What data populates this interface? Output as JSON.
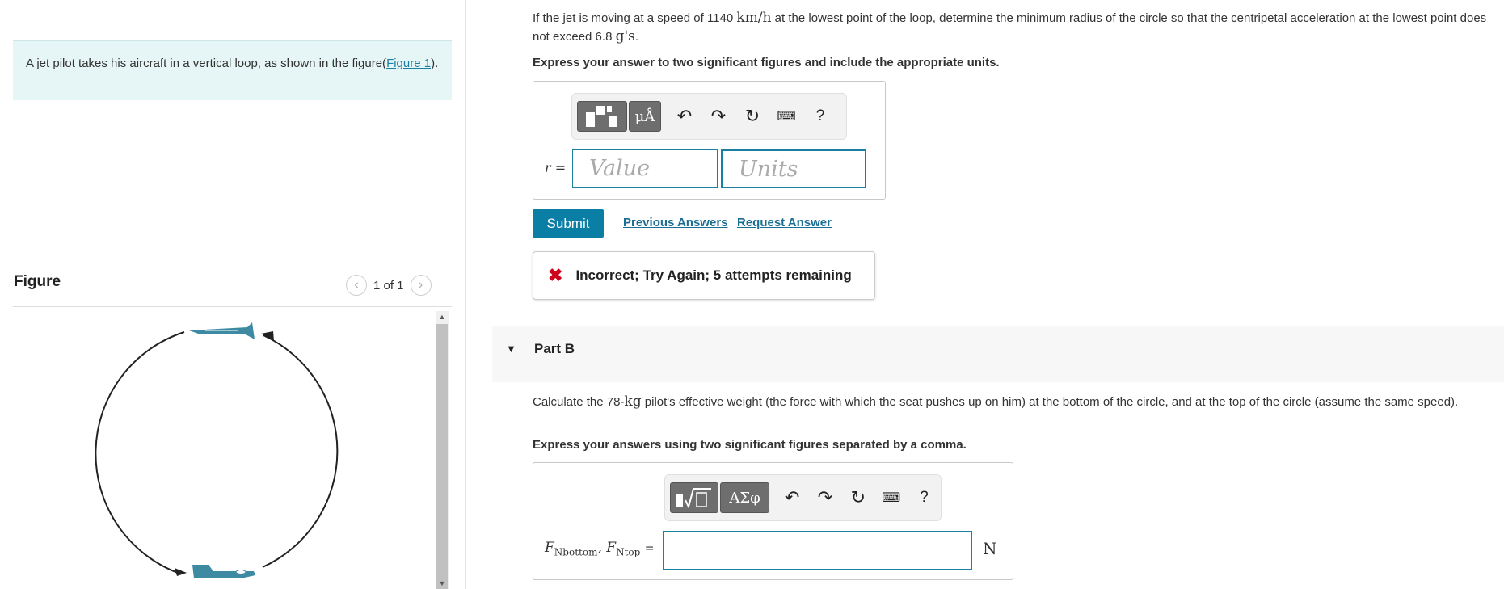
{
  "left": {
    "intro_text": "A jet pilot takes his aircraft in a vertical loop, as shown in the figure(",
    "intro_link": "Figure 1",
    "intro_end": ").",
    "figure_title": "Figure",
    "figure_counter": "1 of 1"
  },
  "partA": {
    "question_pre": "If the jet is moving at a speed of 1140",
    "question_unit": "km/h",
    "question_mid": "at the lowest point of the loop, determine the minimum radius of the circle so that the centripetal acceleration at the lowest point does not exceed 6.8",
    "question_g": "g's",
    "question_end": ".",
    "instruction": "Express your answer to two significant figures and include the appropriate units.",
    "var_label": "r =",
    "value_placeholder": "Value",
    "units_placeholder": "Units",
    "submit": "Submit",
    "previous_answers": "Previous Answers",
    "request_answer": "Request Answer",
    "feedback": "Incorrect; Try Again; 5 attempts remaining",
    "toolbar": {
      "units_btn": "μÅ",
      "help": "?"
    }
  },
  "partB": {
    "title": "Part B",
    "question_pre": "Calculate the 78-",
    "question_unit": "kg",
    "question_post": "pilot's effective weight (the force with which the seat pushes up on him) at the bottom of the circle, and at the top of the circle (assume the same speed).",
    "instruction": "Express your answers using two significant figures separated by a comma.",
    "var_label_f1": "F",
    "var_label_sub1": "Nbottom",
    "var_label_sep": ",",
    "var_label_f2": "F",
    "var_label_sub2": "Ntop",
    "var_label_eq": "=",
    "unit": "N",
    "toolbar": {
      "greek_btn": "ΑΣφ",
      "help": "?"
    }
  },
  "colors": {
    "accent": "#0a7ea4",
    "jet": "#3f8aa3",
    "error": "#d0021b"
  }
}
